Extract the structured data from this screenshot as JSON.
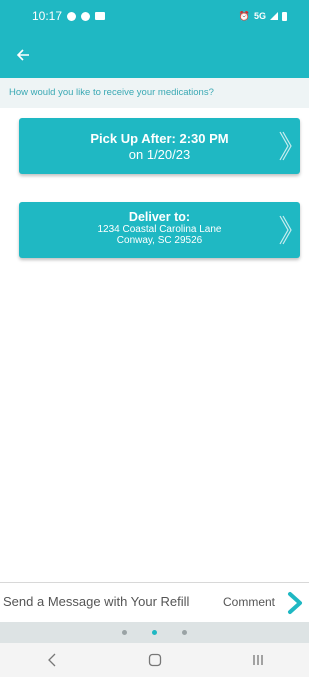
{
  "status_bar": {
    "time": "10:17",
    "network": "5G"
  },
  "prompt": "How would you like to receive your medications?",
  "pickup": {
    "title": "Pick Up After: 2:30 PM",
    "date": "on 1/20/23"
  },
  "delivery": {
    "title": "Deliver to:",
    "address_line1": "1234 Coastal Carolina Lane",
    "address_line2": "Conway, SC 29526"
  },
  "message_bar": {
    "placeholder": "Send a Message with Your Refill",
    "comment_label": "Comment"
  },
  "pager": {
    "pages": 3,
    "active_index": 1
  },
  "colors": {
    "accent": "#1fb8c3",
    "prompt_bg": "#eef4f5",
    "prompt_text": "#3aa9b4"
  }
}
